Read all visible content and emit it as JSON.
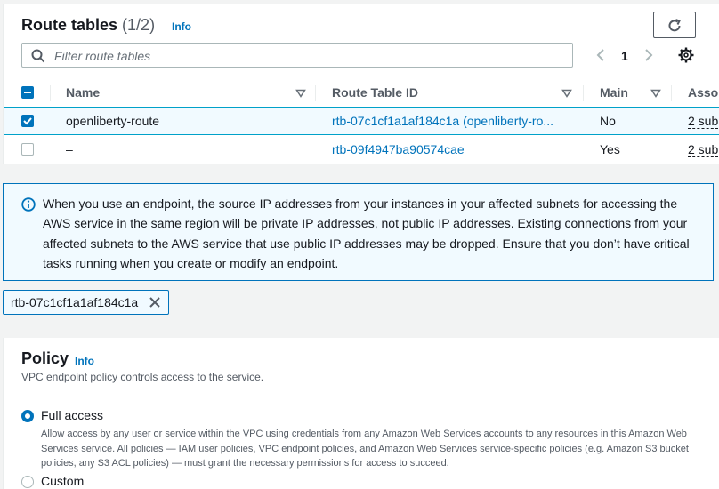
{
  "route_tables": {
    "title": "Route tables",
    "count": "(1/2)",
    "info": "Info",
    "filter_placeholder": "Filter route tables",
    "page": "1",
    "columns": [
      "Name",
      "Route Table ID",
      "Main",
      "Asso"
    ],
    "rows": [
      {
        "name": "openliberty-route",
        "id": "rtb-07c1cf1a1af184c1a (openliberty-ro...",
        "main": "No",
        "assoc": "2 sub",
        "selected": true
      },
      {
        "name": "–",
        "id": "rtb-09f4947ba90574cae",
        "main": "Yes",
        "assoc": "2 sub",
        "selected": false
      }
    ]
  },
  "alert": {
    "text": "When you use an endpoint, the source IP addresses from your instances in your affected subnets for accessing the AWS service in the same region will be private IP addresses, not public IP addresses. Existing connections from your affected subnets to the AWS service that use public IP addresses may be dropped. Ensure that you don’t have critical tasks running when you create or modify an endpoint."
  },
  "selected_token": "rtb-07c1cf1a1af184c1a",
  "policy": {
    "title": "Policy",
    "info": "Info",
    "description": "VPC endpoint policy controls access to the service.",
    "options": [
      {
        "label": "Full access",
        "description": "Allow access by any user or service within the VPC using credentials from any Amazon Web Services accounts to any resources in this Amazon Web Services service. All policies — IAM user policies, VPC endpoint policies, and Amazon Web Services service-specific policies (e.g. Amazon S3 bucket policies, any S3 ACL policies) — must grant the necessary permissions for access to succeed.",
        "selected": true
      },
      {
        "label": "Custom",
        "selected": false
      }
    ]
  },
  "colors": {
    "accent": "#0073bb",
    "link": "#0073bb",
    "selected_row_bg": "#f1faff",
    "text": "#16191f",
    "muted": "#545b64"
  }
}
